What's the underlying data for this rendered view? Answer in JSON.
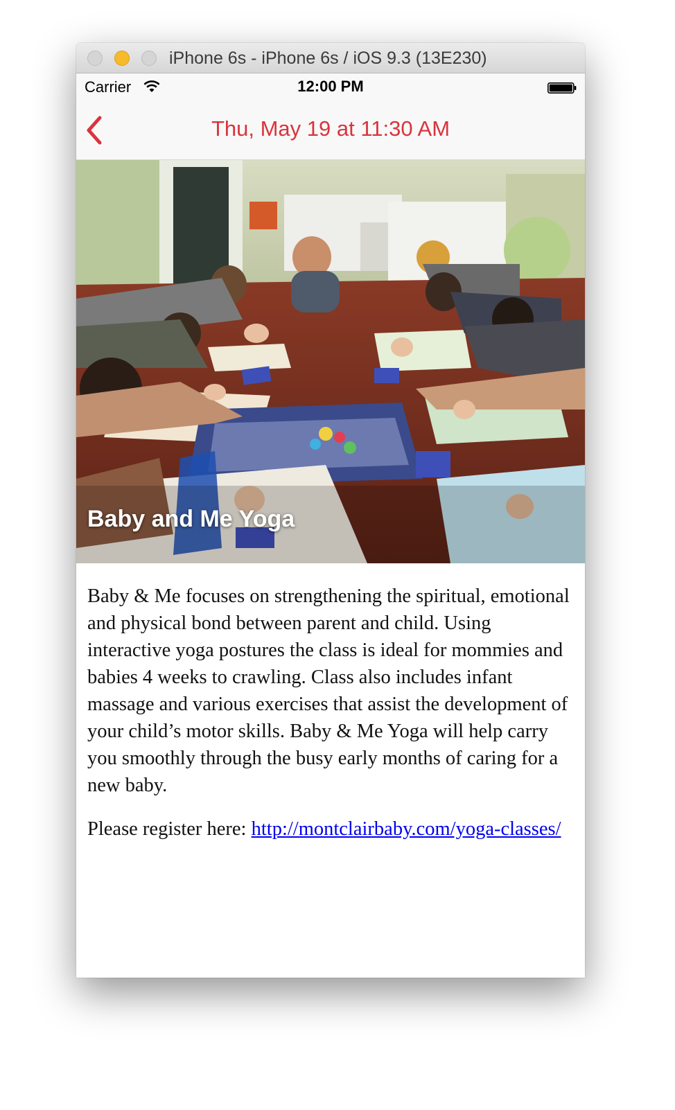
{
  "window": {
    "title": "iPhone 6s - iPhone 6s / iOS 9.3 (13E230)"
  },
  "status_bar": {
    "carrier": "Carrier",
    "time": "12:00 PM",
    "icons": [
      "wifi-icon",
      "battery-icon"
    ]
  },
  "nav": {
    "title": "Thu, May 19 at 11:30 AM",
    "back_icon": "chevron-left-icon"
  },
  "event": {
    "title": "Baby and Me Yoga",
    "description": "Baby & Me focuses on strengthening the spiritual, emotional and physical bond between parent and child. Using interactive yoga postures the class is ideal for mommies and babies 4 weeks to crawling. Class also includes infant massage and various exercises that assist the development of your child’s motor skills. Baby & Me Yoga will help carry you smoothly through the busy early months of caring for a new baby.",
    "register_prefix": "Please register here:",
    "register_link": "http://montclairbaby.com/yoga-classes/"
  },
  "colors": {
    "accent": "#d9343d",
    "link": "#0000ee"
  }
}
